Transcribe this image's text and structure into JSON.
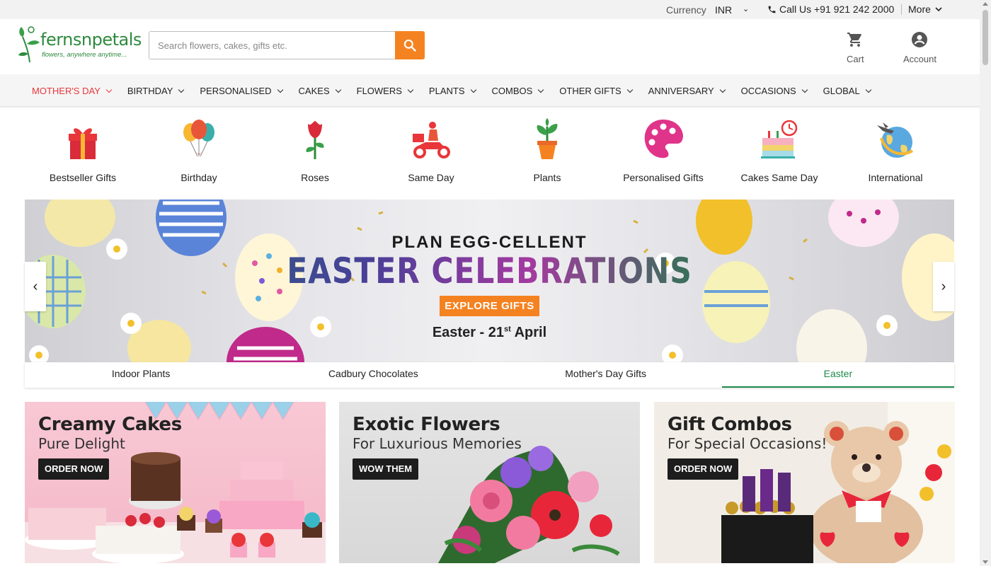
{
  "topbar": {
    "currency_label": "Currency",
    "currency_value": "INR",
    "call_text": "Call Us +91 921 242 2000",
    "more_label": "More"
  },
  "header": {
    "logo_brand": "fernsnpetals",
    "logo_tagline": "flowers, anywhere anytime...",
    "search_placeholder": "Search flowers, cakes, gifts etc.",
    "cart_label": "Cart",
    "account_label": "Account"
  },
  "nav": {
    "items": [
      {
        "label": "MOTHER'S DAY"
      },
      {
        "label": "BIRTHDAY"
      },
      {
        "label": "PERSONALISED"
      },
      {
        "label": "CAKES"
      },
      {
        "label": "FLOWERS"
      },
      {
        "label": "PLANTS"
      },
      {
        "label": "COMBOS"
      },
      {
        "label": "OTHER GIFTS"
      },
      {
        "label": "ANNIVERSARY"
      },
      {
        "label": "OCCASIONS"
      },
      {
        "label": "GLOBAL"
      }
    ],
    "active_color": "#e8363a"
  },
  "categories": [
    {
      "label": "Bestseller Gifts",
      "icon": "gift-box-icon"
    },
    {
      "label": "Birthday",
      "icon": "balloons-icon"
    },
    {
      "label": "Roses",
      "icon": "rose-icon"
    },
    {
      "label": "Same Day",
      "icon": "delivery-scooter-icon"
    },
    {
      "label": "Plants",
      "icon": "potted-plant-icon"
    },
    {
      "label": "Personalised Gifts",
      "icon": "palette-icon"
    },
    {
      "label": "Cakes Same Day",
      "icon": "cake-clock-icon"
    },
    {
      "label": "International",
      "icon": "globe-plane-icon"
    }
  ],
  "banner": {
    "title_top": "PLAN EGG-CELLENT",
    "title_main": "EASTER CELEBRATIONS",
    "cta": "EXPLORE GIFTS",
    "date_prefix": "Easter - 21",
    "date_sup": "st",
    "date_suffix": " April",
    "cta_color": "#f58220"
  },
  "banner_tabs": [
    {
      "label": "Indoor Plants"
    },
    {
      "label": "Cadbury Chocolates"
    },
    {
      "label": "Mother's Day Gifts"
    },
    {
      "label": "Easter"
    }
  ],
  "promo_cards": [
    {
      "title": "Creamy Cakes",
      "subtitle": "Pure Delight",
      "button": "ORDER NOW"
    },
    {
      "title": "Exotic Flowers",
      "subtitle": "For Luxurious Memories",
      "button": "WOW THEM"
    },
    {
      "title": "Gift Combos",
      "subtitle": "For Special Occasions!",
      "button": "ORDER NOW"
    }
  ],
  "colors": {
    "brand_green": "#2e8a3e",
    "accent_orange": "#f58220",
    "active_tab_green": "#1e8a4a"
  }
}
